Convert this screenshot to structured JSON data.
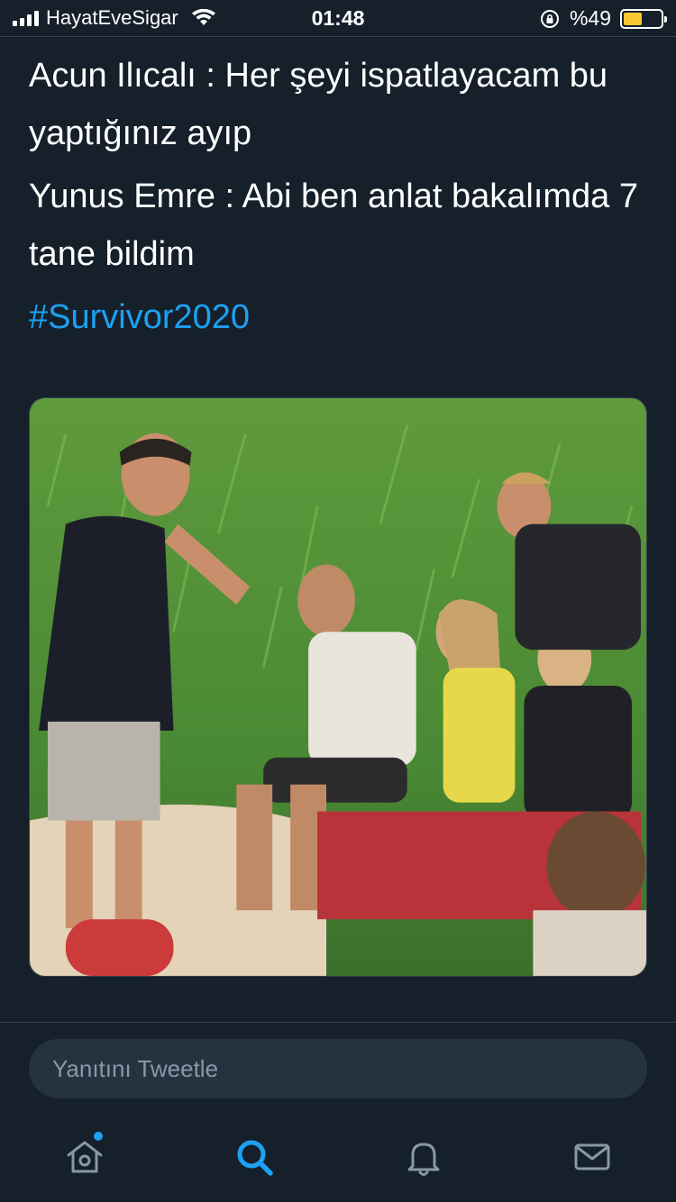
{
  "status_bar": {
    "carrier": "HayatEveSigar",
    "time": "01:48",
    "battery": "%49",
    "battery_level": 0.49,
    "battery_color": "#f7c830"
  },
  "tweet": {
    "paragraphs": [
      "Acun Ilıcalı : Her şeyi ispatlayacam bu yaptığınız ayıp",
      "Yunus Emre : Abi ben anlat bakalımda 7 tane bildim"
    ],
    "hashtag": "#Survivor2020",
    "hashtag_color": "#1da1f2",
    "image": {
      "kind": "photo",
      "subject": "people-sitting-on-beach"
    }
  },
  "reply": {
    "placeholder": "Yanıtını Tweetle"
  },
  "tabbar": {
    "items": [
      "home-icon",
      "search-icon",
      "notifications-icon",
      "messages-icon"
    ],
    "active": "search-icon",
    "accent": "#1da1f2"
  },
  "theme": {
    "background": "#15202b",
    "divider": "#38444d",
    "muted_text": "#8899a6"
  }
}
